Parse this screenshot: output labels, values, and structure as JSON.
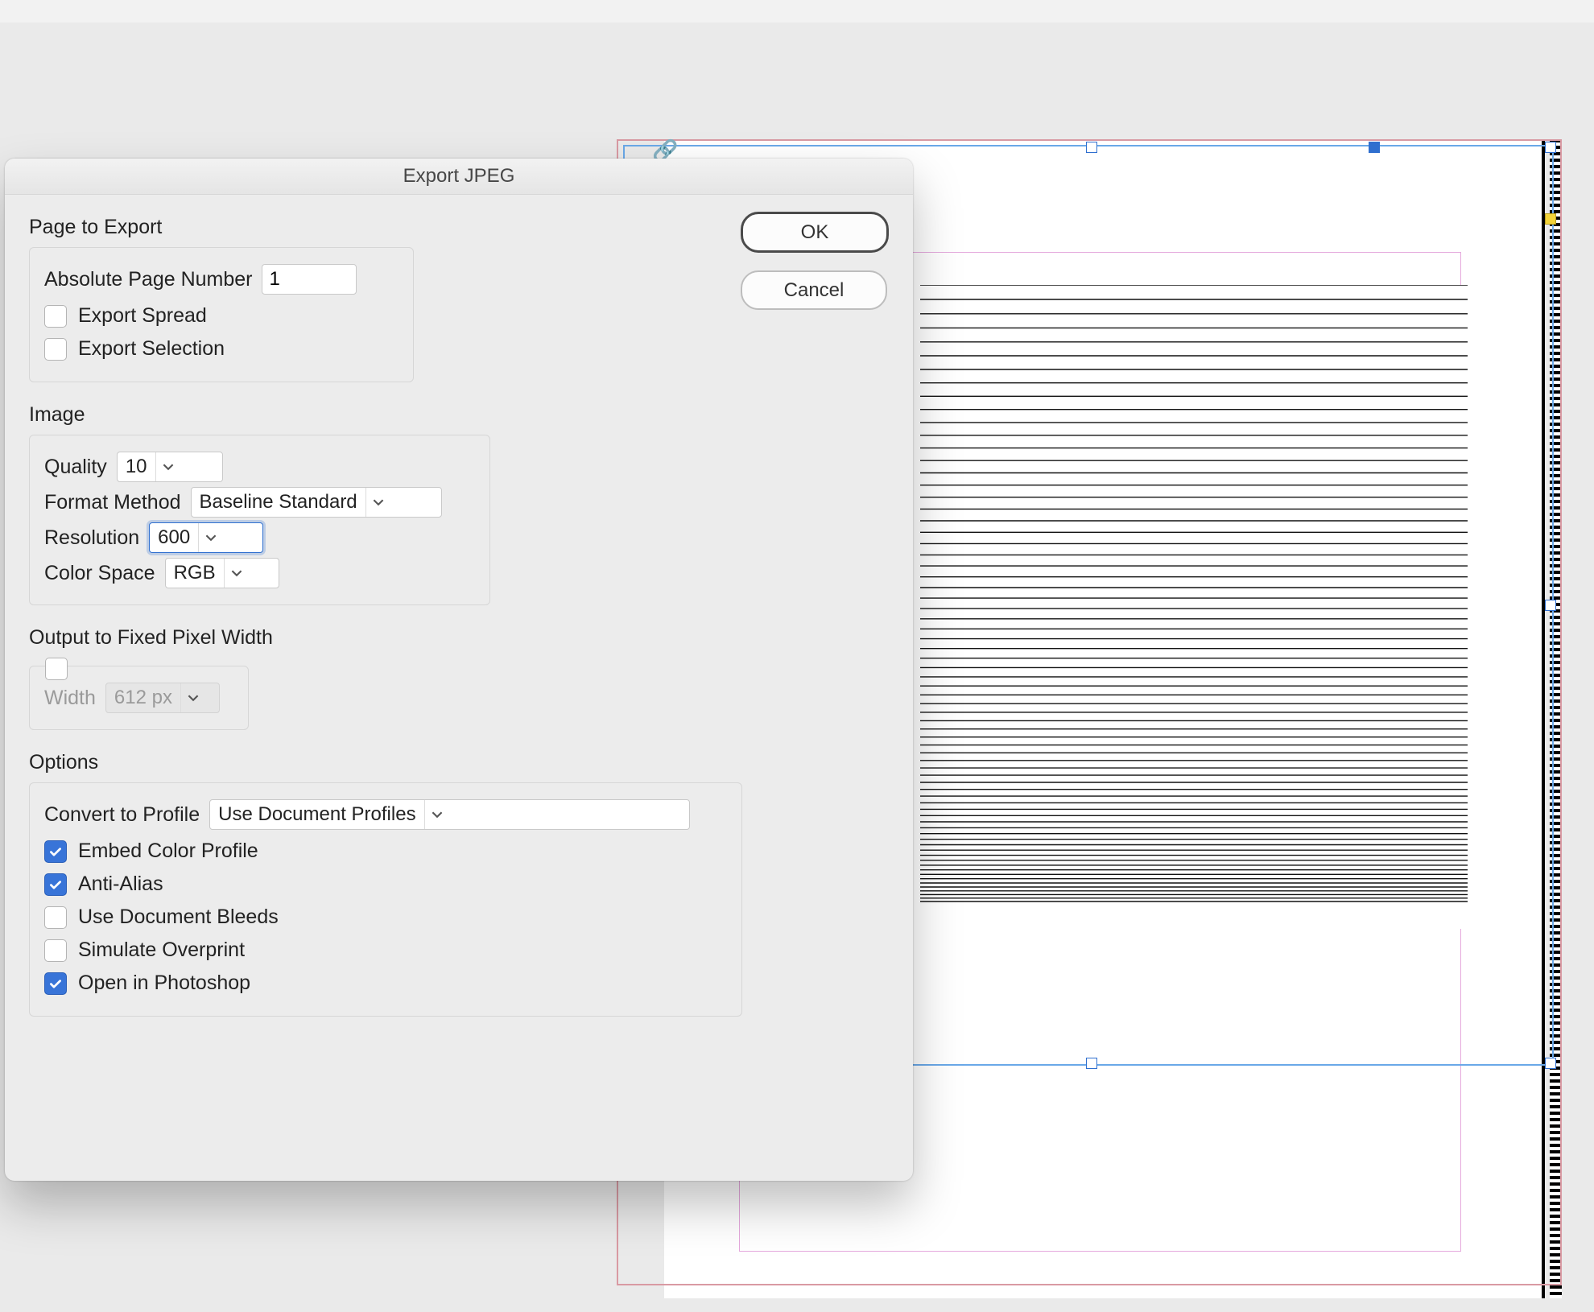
{
  "dialog": {
    "title": "Export JPEG",
    "buttons": {
      "ok": "OK",
      "cancel": "Cancel"
    },
    "page_to_export": {
      "section": "Page to Export",
      "abs_page_label": "Absolute Page Number",
      "abs_page_value": "1",
      "export_spread": {
        "label": "Export Spread",
        "checked": false
      },
      "export_selection": {
        "label": "Export Selection",
        "checked": false
      }
    },
    "image": {
      "section": "Image",
      "quality_label": "Quality",
      "quality_value": "10",
      "format_label": "Format Method",
      "format_value": "Baseline Standard",
      "resolution_label": "Resolution",
      "resolution_value": "600",
      "colorspace_label": "Color Space",
      "colorspace_value": "RGB"
    },
    "fixed_width": {
      "section": "Output to Fixed Pixel Width",
      "enabled": false,
      "width_label": "Width",
      "width_value": "612 px"
    },
    "options": {
      "section": "Options",
      "convert_label": "Convert to Profile",
      "convert_value": "Use Document Profiles",
      "embed_profile": {
        "label": "Embed Color Profile",
        "checked": true
      },
      "anti_alias": {
        "label": "Anti-Alias",
        "checked": true
      },
      "use_bleeds": {
        "label": "Use Document Bleeds",
        "checked": false
      },
      "sim_overprint": {
        "label": "Simulate Overprint",
        "checked": false
      },
      "open_ps": {
        "label": "Open in Photoshop",
        "checked": true
      }
    }
  }
}
